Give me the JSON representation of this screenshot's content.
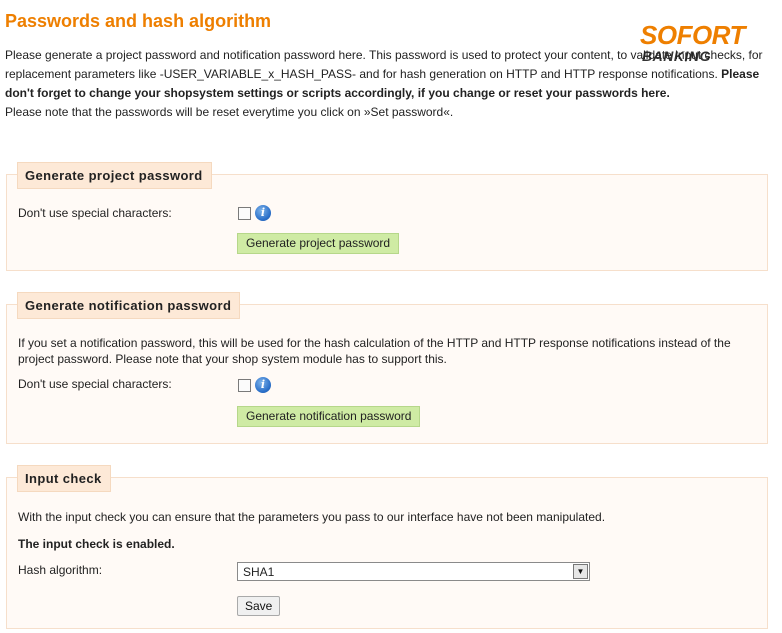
{
  "page": {
    "title": "Passwords and hash algorithm",
    "logo": {
      "line1": "SOFORT",
      "line2": "BANKING"
    },
    "intro_text": "Please generate a project password and notification password here. This password is used to protect your content, to validate input checks, for replacement parameters like -USER_VARIABLE_x_HASH_PASS- and for hash generation on HTTP and HTTP response notifications.",
    "intro_bold": "Please don't forget to change your shopsystem settings or scripts accordingly, if you change or reset your passwords here.",
    "reset_note": "Please note that the passwords will be reset everytime you click on »Set password«."
  },
  "project_section": {
    "legend": "Generate project password",
    "special_chars_label": "Don't use special characters:",
    "info_icon": "info-icon",
    "button_label": "Generate project password"
  },
  "notification_section": {
    "legend": "Generate notification password",
    "description": "If you set a notification password, this will be used for the hash calculation of the HTTP and HTTP response notifications instead of the project password. Please note that your shop system module has to support this.",
    "special_chars_label": "Don't use special characters:",
    "info_icon": "info-icon",
    "button_label": "Generate notification password"
  },
  "input_check_section": {
    "legend": "Input check",
    "description": "With the input check you can ensure that the parameters you pass to our interface have not been manipulated.",
    "status": "The input check is enabled.",
    "hash_label": "Hash algorithm:",
    "hash_value": "SHA1",
    "save_label": "Save"
  },
  "colors": {
    "accent": "#ee7f00",
    "legend_bg": "#fde9d7",
    "button_green": "#cfeba4",
    "section_border": "#f6dfcb"
  }
}
